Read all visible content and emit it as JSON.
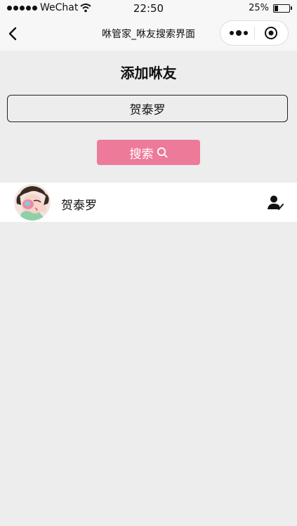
{
  "status_bar": {
    "carrier": "WeChat",
    "time": "22:50",
    "battery_text": "25%",
    "battery_level": 0.25
  },
  "nav": {
    "title": "咻管家_咻友搜索界面"
  },
  "page": {
    "heading": "添加咻友"
  },
  "search": {
    "value": "贺泰罗",
    "button_label": "搜索"
  },
  "results": [
    {
      "name": "贺泰罗"
    }
  ],
  "colors": {
    "accent": "#ee7a9a",
    "background": "#ededed"
  }
}
